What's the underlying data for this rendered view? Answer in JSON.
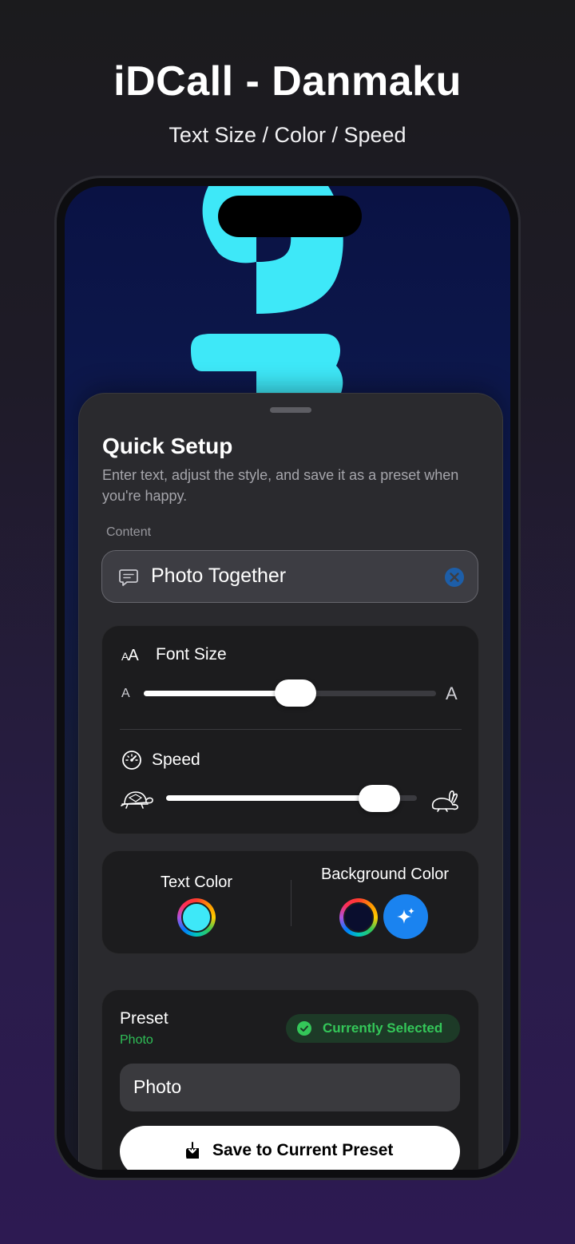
{
  "promo": {
    "title": "iDCall - Danmaku",
    "subtitle": "Text Size / Color / Speed"
  },
  "colors": {
    "danmaku_text": "#3ee8f8",
    "accent_blue": "#1a83f0",
    "success_green": "#34c759"
  },
  "sheet": {
    "title": "Quick Setup",
    "description": "Enter text, adjust the style, and save it as a preset when you're happy.",
    "content_label": "Content",
    "content_value": "Photo Together",
    "font_size": {
      "label": "Font Size",
      "icon_big": "A",
      "icon_small": "A",
      "min_label": "A",
      "max_label": "A",
      "value_fraction": 0.52
    },
    "speed": {
      "label": "Speed",
      "value_fraction": 0.85
    },
    "colors_card": {
      "text_color_label": "Text Color",
      "background_color_label": "Background Color",
      "text_color_value": "#3ee8f8",
      "background_color_value": "#0a0e2e"
    },
    "preset": {
      "title": "Preset",
      "subtitle": "Photo",
      "badge": "Currently Selected",
      "name_value": "Photo",
      "save_button": "Save to Current Preset"
    }
  },
  "icons": {
    "message": "message-bubble-icon",
    "clear": "clear-x-icon",
    "font": "font-size-icon",
    "speed": "speedometer-icon",
    "slow": "turtle-icon",
    "fast": "rabbit-icon",
    "sparkle": "sparkles-icon",
    "check": "checkmark-circle-icon",
    "save": "download-tray-icon"
  }
}
